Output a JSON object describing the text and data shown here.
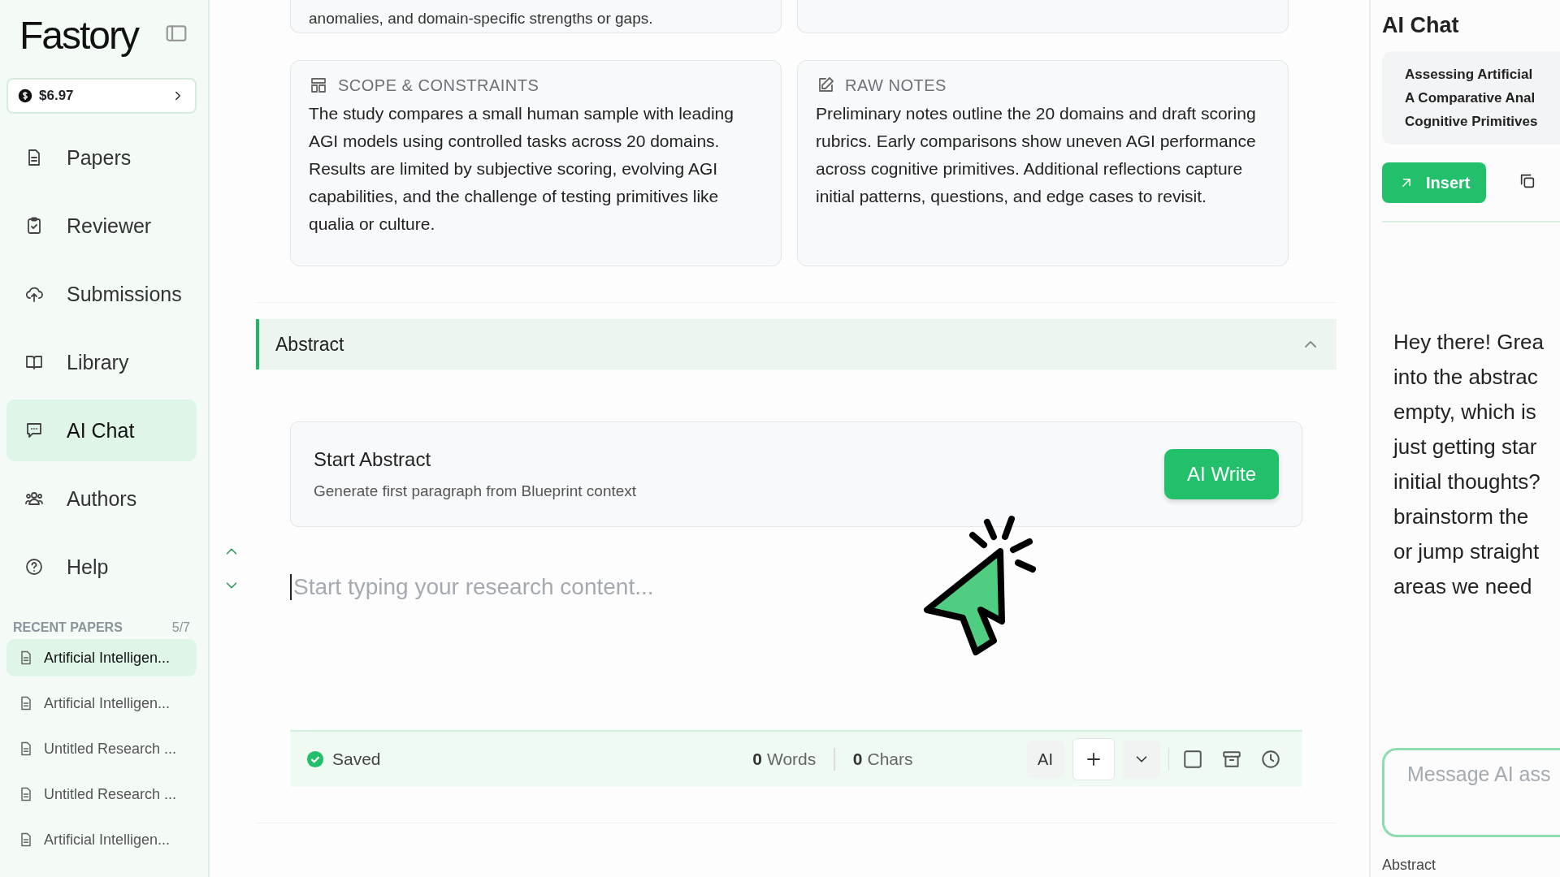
{
  "sidebar": {
    "logo": "Fastory",
    "balance": "$6.97",
    "nav": [
      {
        "label": "Papers",
        "kind": "doc",
        "selected": false
      },
      {
        "label": "Reviewer",
        "kind": "clipboard",
        "selected": false
      },
      {
        "label": "Submissions",
        "kind": "upload",
        "selected": false
      },
      {
        "label": "Library",
        "kind": "book",
        "selected": false
      },
      {
        "label": "AI Chat",
        "kind": "chat",
        "selected": true
      },
      {
        "label": "Authors",
        "kind": "users",
        "selected": false
      },
      {
        "label": "Help",
        "kind": "help",
        "selected": false
      }
    ],
    "recent": {
      "title": "RECENT PAPERS",
      "count": "5/7",
      "items": [
        {
          "label": "Artificial Intelligen...",
          "selected": true
        },
        {
          "label": "Artificial Intelligen...",
          "selected": false
        },
        {
          "label": "Untitled Research ...",
          "selected": false
        },
        {
          "label": "Untitled Research ...",
          "selected": false
        },
        {
          "label": "Artificial Intelligen...",
          "selected": false
        }
      ]
    }
  },
  "blueprint": {
    "top_text": "anomalies, and domain-specific strengths or gaps.",
    "cards": [
      {
        "kind": "layout",
        "title": "SCOPE & CONSTRAINTS",
        "text": "The study compares a small human sample with leading AGI models using controlled tasks across 20 domains. Results are limited by subjective scoring, evolving AGI capabilities, and the challenge of testing primitives like qualia or culture."
      },
      {
        "kind": "edit",
        "title": "RAW NOTES",
        "text": "Preliminary notes outline the 20 domains and draft scoring rubrics. Early comparisons show uneven AGI performance across cognitive primitives. Additional reflections capture initial patterns, questions, and edge cases to revisit."
      }
    ]
  },
  "section": {
    "title": "Abstract",
    "expanded": true,
    "start": {
      "title": "Start Abstract",
      "subtitle": "Generate first paragraph from Blueprint context",
      "button": "AI Write"
    },
    "editor": {
      "placeholder": "Start typing your research content..."
    },
    "status": {
      "saved": "Saved",
      "words_count": "0",
      "words": "Words",
      "chars_count": "0",
      "chars": "Chars",
      "ai": "AI"
    }
  },
  "chat": {
    "title": "AI Chat",
    "context_lines": [
      "Assessing Artificial",
      "A Comparative Anal",
      "Cognitive Primitives"
    ],
    "insert": "Insert",
    "message_lines": [
      "Hey there! Grea",
      "into the abstrac",
      "empty, which is",
      "just getting star",
      "initial thoughts?",
      "brainstorm the",
      "or jump straight",
      "areas we need"
    ],
    "input": {
      "placeholder": "Message AI ass"
    },
    "footer": "Abstract"
  }
}
